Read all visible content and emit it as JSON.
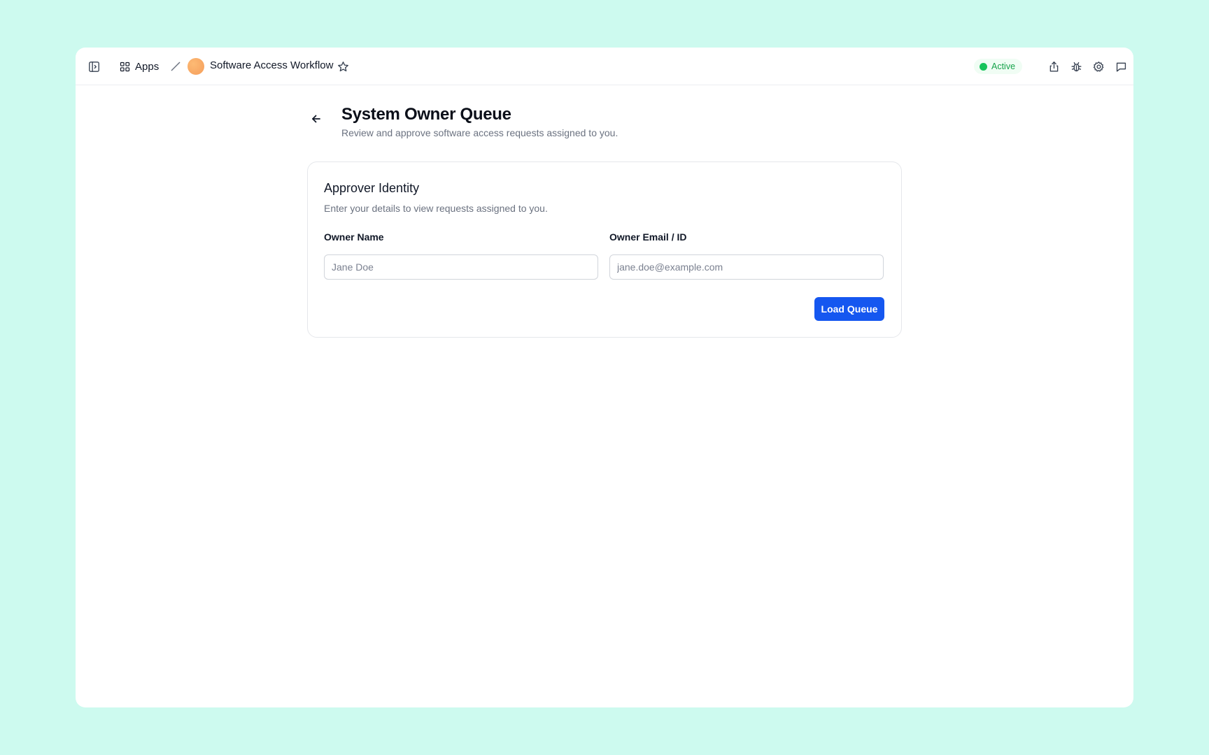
{
  "topbar": {
    "apps_label": "Apps",
    "app_title": "Software Access Workflow",
    "status_label": "Active",
    "status_color": "#16c45a"
  },
  "icons": {
    "sidebar_toggle": "sidebar-panel-icon",
    "apps": "grid-icon",
    "separator": "slash-icon",
    "favorite": "star-icon",
    "share": "share-icon",
    "debug": "bug-icon",
    "settings": "gear-icon",
    "chat": "chat-bubble-icon",
    "back": "arrow-left-icon"
  },
  "page": {
    "title": "System Owner Queue",
    "subtitle": "Review and approve software access requests assigned to you."
  },
  "card": {
    "title": "Approver Identity",
    "description": "Enter your details to view requests assigned to you.",
    "owner_name_label": "Owner Name",
    "owner_name_value": "",
    "owner_name_placeholder": "Jane Doe",
    "owner_email_label": "Owner Email / ID",
    "owner_email_value": "",
    "owner_email_placeholder": "jane.doe@example.com",
    "submit_label": "Load Queue",
    "accent_color": "#1557f0"
  }
}
